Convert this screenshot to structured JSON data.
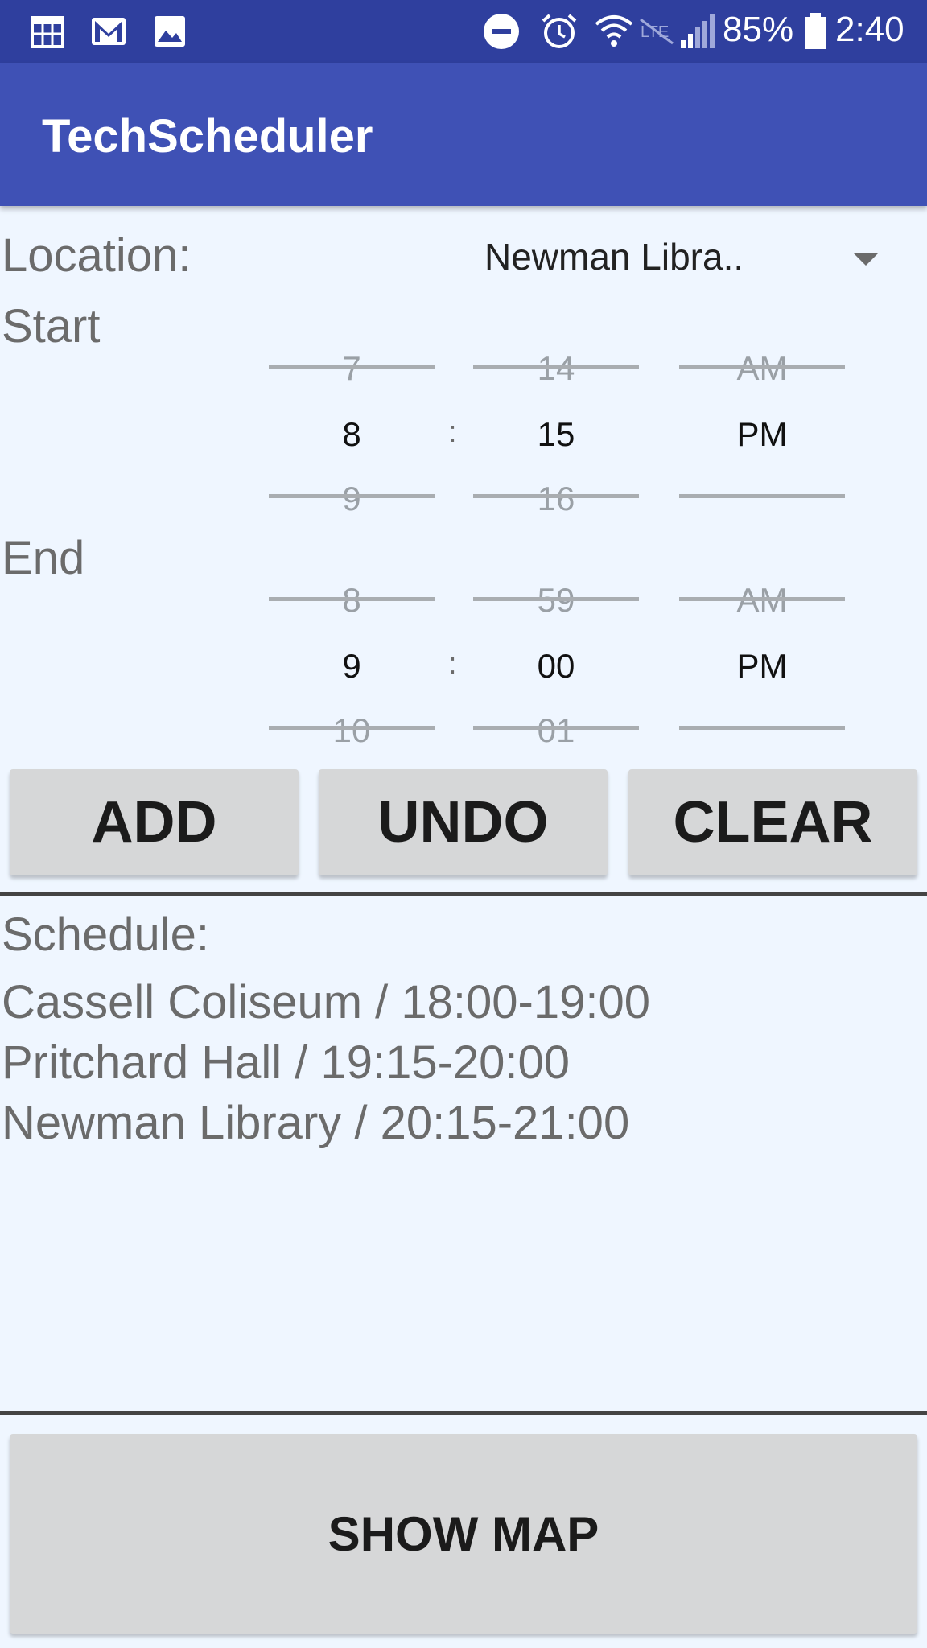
{
  "status_bar": {
    "icons": [
      "calendar-icon",
      "gmail-icon",
      "image-icon",
      "do-not-disturb-icon",
      "alarm-icon",
      "wifi-icon",
      "lte-off-icon",
      "signal-icon",
      "battery-icon"
    ],
    "battery": "85%",
    "time": "2:40"
  },
  "app_bar": {
    "title": "TechScheduler"
  },
  "location": {
    "label": "Location:",
    "value": "Newman Libra.."
  },
  "start": {
    "label": "Start",
    "hour": {
      "prev": "7",
      "current": "8",
      "next": "9"
    },
    "minute": {
      "prev": "14",
      "current": "15",
      "next": "16"
    },
    "ampm": {
      "prev": "AM",
      "current": "PM",
      "next": ""
    },
    "separator": ":"
  },
  "end": {
    "label": "End",
    "hour": {
      "prev": "8",
      "current": "9",
      "next": "10"
    },
    "minute": {
      "prev": "59",
      "current": "00",
      "next": "01"
    },
    "ampm": {
      "prev": "AM",
      "current": "PM",
      "next": ""
    },
    "separator": ":"
  },
  "buttons": {
    "add": "ADD",
    "undo": "UNDO",
    "clear": "CLEAR",
    "show_map": "SHOW MAP"
  },
  "schedule": {
    "label": "Schedule:",
    "entries": [
      "Cassell Coliseum / 18:00-19:00",
      "Pritchard Hall / 19:15-20:00",
      "Newman Library / 20:15-21:00"
    ]
  },
  "colors": {
    "status_bar": "#2f3f9e",
    "app_bar": "#3f51b5",
    "background": "#eff6ff",
    "button": "#d6d7d8"
  }
}
